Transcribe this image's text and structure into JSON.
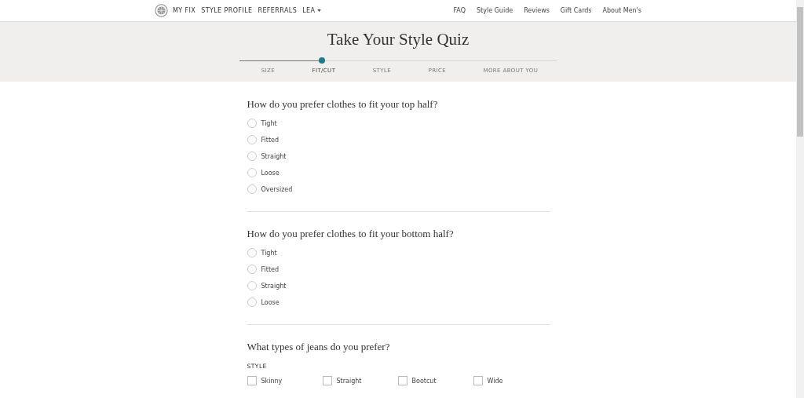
{
  "nav": {
    "left": [
      "MY FIX",
      "STYLE PROFILE",
      "REFERRALS",
      "LEA"
    ],
    "right": [
      "FAQ",
      "Style Guide",
      "Reviews",
      "Gift Cards",
      "About Men's"
    ]
  },
  "header": {
    "title": "Take Your Style Quiz",
    "progress": {
      "level": 0.26
    },
    "steps": [
      {
        "label": "SIZE",
        "selected": false
      },
      {
        "label": "FIT/CUT",
        "selected": true
      },
      {
        "label": "STYLE",
        "selected": false
      },
      {
        "label": "PRICE",
        "selected": false
      },
      {
        "label": "MORE ABOUT YOU",
        "selected": false
      }
    ]
  },
  "questions": [
    {
      "kind": "radio",
      "question": "How do you prefer clothes to fit your top half?",
      "options": [
        {
          "label": "Tight",
          "selected": false
        },
        {
          "label": "Fitted",
          "selected": false
        },
        {
          "label": "Straight",
          "selected": false
        },
        {
          "label": "Loose",
          "selected": false
        },
        {
          "label": "Oversized",
          "selected": false
        }
      ]
    },
    {
      "kind": "radio",
      "question": "How do you prefer clothes to fit your bottom half?",
      "options": [
        {
          "label": "Tight",
          "selected": false
        },
        {
          "label": "Fitted",
          "selected": false
        },
        {
          "label": "Straight",
          "selected": false
        },
        {
          "label": "Loose",
          "selected": false
        }
      ]
    },
    {
      "kind": "checkbox",
      "question": "What types of jeans do you prefer?",
      "group": "STYLE",
      "options": [
        {
          "label": "Skinny",
          "checked": false
        },
        {
          "label": "Straight",
          "checked": false
        },
        {
          "label": "Bootcut",
          "checked": false
        },
        {
          "label": "Wide",
          "checked": false
        }
      ]
    }
  ]
}
